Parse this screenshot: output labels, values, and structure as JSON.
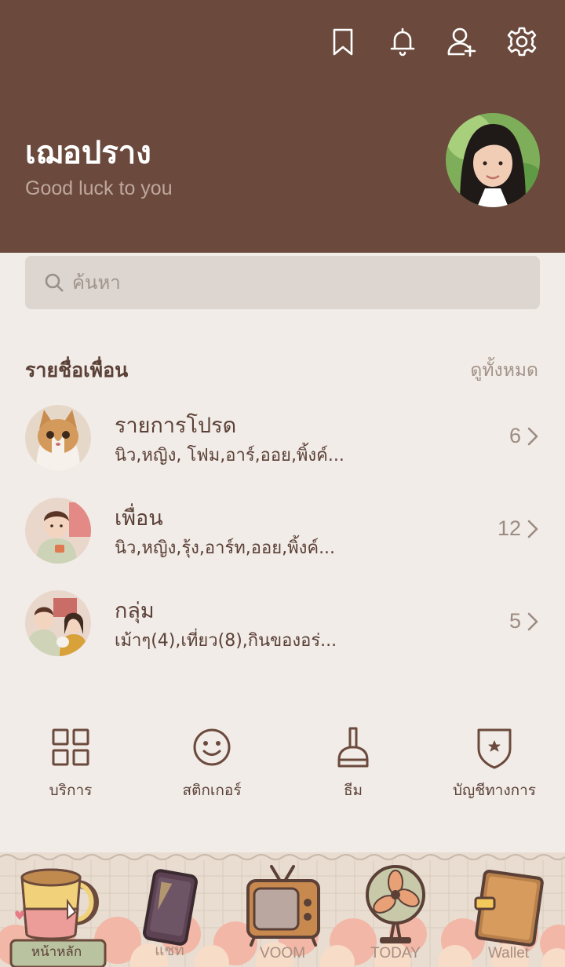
{
  "header": {
    "icons": [
      "bookmark-icon",
      "bell-icon",
      "add-friend-icon",
      "gear-icon"
    ],
    "profile_name": "เฌอปราง",
    "status_message": "Good luck to you",
    "background": "#6b4a3d"
  },
  "search": {
    "placeholder": "ค้นหา"
  },
  "friends_section": {
    "title": "รายชื่อเพื่อน",
    "see_all": "ดูทั้งหมด",
    "items": [
      {
        "title": "รายการโปรด",
        "subtitle": "นิว,หญิง, โฟม,อาร์,ออย,พิ้งค์...",
        "count": "6"
      },
      {
        "title": "เพื่อน",
        "subtitle": "นิว,หญิง,รุ้ง,อาร์ท,ออย,พิ้งค์...",
        "count": "12"
      },
      {
        "title": "กลุ่ม",
        "subtitle": "เม้าๆ(4),เที่ยว(8),กินของอร่...",
        "count": "5"
      }
    ]
  },
  "shortcuts": [
    {
      "label": "บริการ",
      "icon": "grid-icon"
    },
    {
      "label": "สติกเกอร์",
      "icon": "smiley-icon"
    },
    {
      "label": "ธีม",
      "icon": "brush-icon"
    },
    {
      "label": "บัญชีทางการ",
      "icon": "shield-star-icon"
    }
  ],
  "tabbar": {
    "tabs": [
      {
        "label": "หน้าหลัก",
        "icon": "mug-icon",
        "active": true
      },
      {
        "label": "แชท",
        "icon": "phone-icon"
      },
      {
        "label": "VOOM",
        "icon": "tv-icon"
      },
      {
        "label": "TODAY",
        "icon": "fan-icon"
      },
      {
        "label": "Wallet",
        "icon": "wallet-icon"
      }
    ]
  }
}
